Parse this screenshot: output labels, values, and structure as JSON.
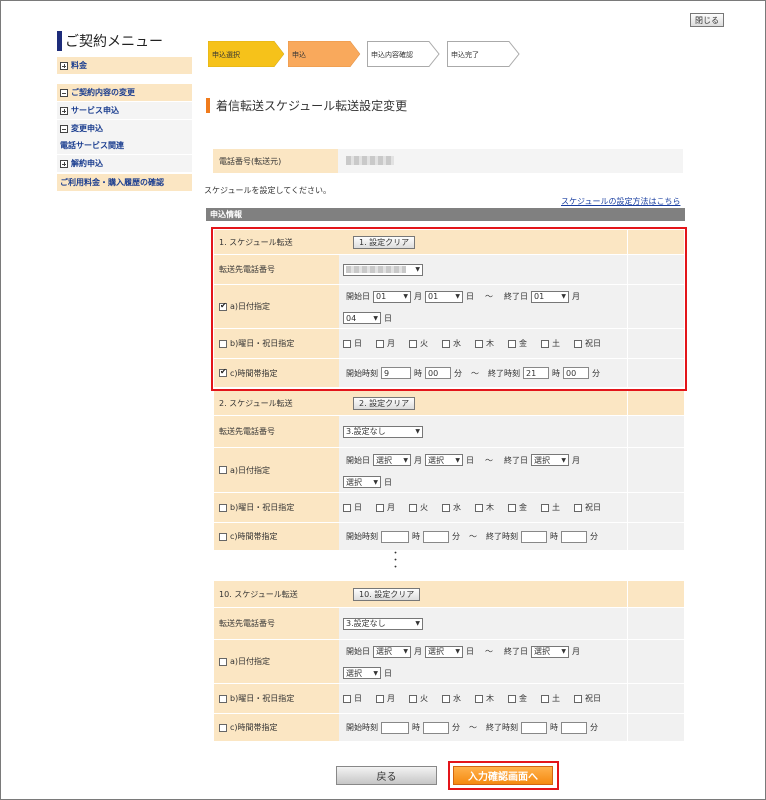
{
  "header": {
    "close_label": "閉じる"
  },
  "sidebar": {
    "title": "ご契約メニュー",
    "items": [
      {
        "label": "料金",
        "icon": "plus-box-icon"
      },
      {
        "label": "ご契約内容の変更",
        "icon": "minus-box-icon"
      },
      {
        "label": "サービス申込",
        "icon": "plus-box-icon"
      },
      {
        "label": "変更申込",
        "icon": "minus-box-icon"
      },
      {
        "label": "電話サービス関連",
        "icon": ""
      },
      {
        "label": "解約申込",
        "icon": "plus-box-icon"
      },
      {
        "label": "ご利用料金・購入履歴の確認",
        "icon": ""
      }
    ]
  },
  "steps": [
    {
      "label": "申込選択",
      "color": "#f6c21a"
    },
    {
      "label": "申込",
      "color": "#f9a95c"
    },
    {
      "label": "申込内容確認",
      "color": "#ffffff"
    },
    {
      "label": "申込完了",
      "color": "#ffffff"
    }
  ],
  "page": {
    "title": "着信転送スケジュール転送設定変更",
    "tel_label": "電話番号(転送元)",
    "instruction": "スケジュールを設定してください。",
    "help_link": "スケジュールの設定方法はこちら",
    "section_title": "申込情報"
  },
  "labels": {
    "dest_phone": "転送先電話番号",
    "date_spec": "a)日付指定",
    "weekday_spec": "b)曜日・祝日指定",
    "time_spec": "c)時間帯指定",
    "start_date": "開始日",
    "end_date": "終了日",
    "month": "月",
    "day": "日",
    "tilde": "〜",
    "start_time": "開始時刻",
    "end_time": "終了時刻",
    "hour": "時",
    "minute": "分",
    "days": [
      "日",
      "月",
      "火",
      "水",
      "木",
      "金",
      "土",
      "祝日"
    ],
    "dots": "・\n・\n・"
  },
  "schedules": [
    {
      "title": "1. スケジュール転送",
      "clear_label": "1. 設定クリア",
      "dest_value": "",
      "date_checked": true,
      "weekday_checked": false,
      "time_checked": true,
      "start_month": "01",
      "start_day": "01",
      "end_month": "01",
      "end_day": "04",
      "start_hour": "9",
      "start_min": "00",
      "end_hour": "21",
      "end_min": "00"
    },
    {
      "title": "2. スケジュール転送",
      "clear_label": "2. 設定クリア",
      "dest_value": "3.設定なし",
      "date_checked": false,
      "weekday_checked": false,
      "time_checked": false,
      "start_month": "選択",
      "start_day": "選択",
      "end_month": "選択",
      "end_day": "選択",
      "start_hour": "",
      "start_min": "",
      "end_hour": "",
      "end_min": ""
    },
    {
      "title": "10. スケジュール転送",
      "clear_label": "10. 設定クリア",
      "dest_value": "3.設定なし",
      "date_checked": false,
      "weekday_checked": false,
      "time_checked": false,
      "start_month": "選択",
      "start_day": "選択",
      "end_month": "選択",
      "end_day": "選択",
      "start_hour": "",
      "start_min": "",
      "end_hour": "",
      "end_min": ""
    }
  ],
  "footer": {
    "back_label": "戻る",
    "next_label": "入力確認画面へ"
  },
  "colors": {
    "highlight": "#e3151a",
    "accent": "#f58a10",
    "label_bg": "#fbe6c3"
  }
}
